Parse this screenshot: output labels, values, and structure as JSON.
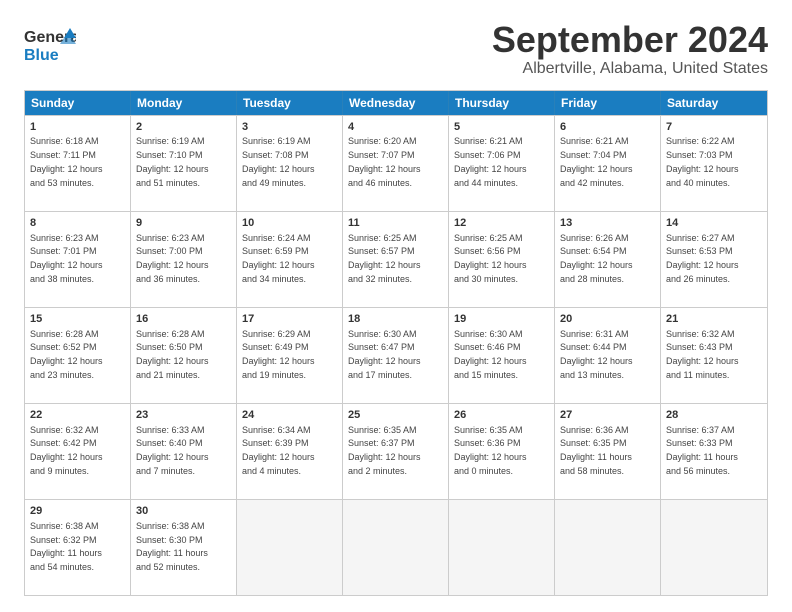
{
  "logo": {
    "general": "General",
    "blue": "Blue"
  },
  "title": "September 2024",
  "subtitle": "Albertville, Alabama, United States",
  "headers": [
    "Sunday",
    "Monday",
    "Tuesday",
    "Wednesday",
    "Thursday",
    "Friday",
    "Saturday"
  ],
  "rows": [
    [
      {
        "day": "",
        "info": ""
      },
      {
        "day": "2",
        "info": "Sunrise: 6:19 AM\nSunset: 7:10 PM\nDaylight: 12 hours\nand 51 minutes."
      },
      {
        "day": "3",
        "info": "Sunrise: 6:19 AM\nSunset: 7:08 PM\nDaylight: 12 hours\nand 49 minutes."
      },
      {
        "day": "4",
        "info": "Sunrise: 6:20 AM\nSunset: 7:07 PM\nDaylight: 12 hours\nand 46 minutes."
      },
      {
        "day": "5",
        "info": "Sunrise: 6:21 AM\nSunset: 7:06 PM\nDaylight: 12 hours\nand 44 minutes."
      },
      {
        "day": "6",
        "info": "Sunrise: 6:21 AM\nSunset: 7:04 PM\nDaylight: 12 hours\nand 42 minutes."
      },
      {
        "day": "7",
        "info": "Sunrise: 6:22 AM\nSunset: 7:03 PM\nDaylight: 12 hours\nand 40 minutes."
      }
    ],
    [
      {
        "day": "8",
        "info": "Sunrise: 6:23 AM\nSunset: 7:01 PM\nDaylight: 12 hours\nand 38 minutes."
      },
      {
        "day": "9",
        "info": "Sunrise: 6:23 AM\nSunset: 7:00 PM\nDaylight: 12 hours\nand 36 minutes."
      },
      {
        "day": "10",
        "info": "Sunrise: 6:24 AM\nSunset: 6:59 PM\nDaylight: 12 hours\nand 34 minutes."
      },
      {
        "day": "11",
        "info": "Sunrise: 6:25 AM\nSunset: 6:57 PM\nDaylight: 12 hours\nand 32 minutes."
      },
      {
        "day": "12",
        "info": "Sunrise: 6:25 AM\nSunset: 6:56 PM\nDaylight: 12 hours\nand 30 minutes."
      },
      {
        "day": "13",
        "info": "Sunrise: 6:26 AM\nSunset: 6:54 PM\nDaylight: 12 hours\nand 28 minutes."
      },
      {
        "day": "14",
        "info": "Sunrise: 6:27 AM\nSunset: 6:53 PM\nDaylight: 12 hours\nand 26 minutes."
      }
    ],
    [
      {
        "day": "15",
        "info": "Sunrise: 6:28 AM\nSunset: 6:52 PM\nDaylight: 12 hours\nand 23 minutes."
      },
      {
        "day": "16",
        "info": "Sunrise: 6:28 AM\nSunset: 6:50 PM\nDaylight: 12 hours\nand 21 minutes."
      },
      {
        "day": "17",
        "info": "Sunrise: 6:29 AM\nSunset: 6:49 PM\nDaylight: 12 hours\nand 19 minutes."
      },
      {
        "day": "18",
        "info": "Sunrise: 6:30 AM\nSunset: 6:47 PM\nDaylight: 12 hours\nand 17 minutes."
      },
      {
        "day": "19",
        "info": "Sunrise: 6:30 AM\nSunset: 6:46 PM\nDaylight: 12 hours\nand 15 minutes."
      },
      {
        "day": "20",
        "info": "Sunrise: 6:31 AM\nSunset: 6:44 PM\nDaylight: 12 hours\nand 13 minutes."
      },
      {
        "day": "21",
        "info": "Sunrise: 6:32 AM\nSunset: 6:43 PM\nDaylight: 12 hours\nand 11 minutes."
      }
    ],
    [
      {
        "day": "22",
        "info": "Sunrise: 6:32 AM\nSunset: 6:42 PM\nDaylight: 12 hours\nand 9 minutes."
      },
      {
        "day": "23",
        "info": "Sunrise: 6:33 AM\nSunset: 6:40 PM\nDaylight: 12 hours\nand 7 minutes."
      },
      {
        "day": "24",
        "info": "Sunrise: 6:34 AM\nSunset: 6:39 PM\nDaylight: 12 hours\nand 4 minutes."
      },
      {
        "day": "25",
        "info": "Sunrise: 6:35 AM\nSunset: 6:37 PM\nDaylight: 12 hours\nand 2 minutes."
      },
      {
        "day": "26",
        "info": "Sunrise: 6:35 AM\nSunset: 6:36 PM\nDaylight: 12 hours\nand 0 minutes."
      },
      {
        "day": "27",
        "info": "Sunrise: 6:36 AM\nSunset: 6:35 PM\nDaylight: 11 hours\nand 58 minutes."
      },
      {
        "day": "28",
        "info": "Sunrise: 6:37 AM\nSunset: 6:33 PM\nDaylight: 11 hours\nand 56 minutes."
      }
    ],
    [
      {
        "day": "29",
        "info": "Sunrise: 6:38 AM\nSunset: 6:32 PM\nDaylight: 11 hours\nand 54 minutes."
      },
      {
        "day": "30",
        "info": "Sunrise: 6:38 AM\nSunset: 6:30 PM\nDaylight: 11 hours\nand 52 minutes."
      },
      {
        "day": "",
        "info": ""
      },
      {
        "day": "",
        "info": ""
      },
      {
        "day": "",
        "info": ""
      },
      {
        "day": "",
        "info": ""
      },
      {
        "day": "",
        "info": ""
      }
    ]
  ],
  "row0_day1": {
    "day": "1",
    "info": "Sunrise: 6:18 AM\nSunset: 7:11 PM\nDaylight: 12 hours\nand 53 minutes."
  }
}
